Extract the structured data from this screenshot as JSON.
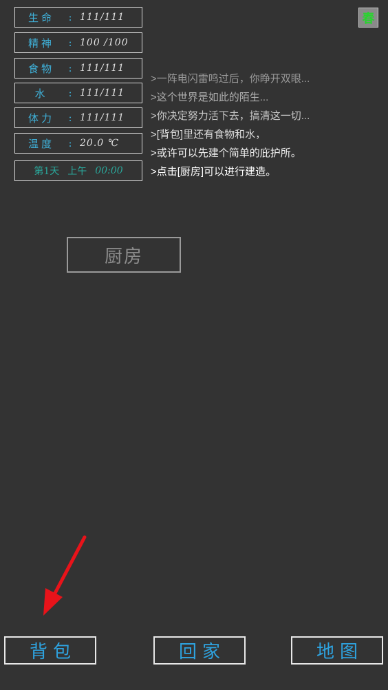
{
  "stats": [
    {
      "label": "生命",
      "separator": ":",
      "value": "111/111"
    },
    {
      "label": "精神",
      "separator": ":",
      "value": "100 /100"
    },
    {
      "label": "食物",
      "separator": ":",
      "value": "111/111"
    },
    {
      "label": "水",
      "separator": ":",
      "value": "111/111"
    },
    {
      "label": "体力",
      "separator": ":",
      "value": "111/111"
    },
    {
      "label": "温度",
      "separator": ":",
      "value": "20.0  ℃"
    }
  ],
  "time": {
    "day": "第1天",
    "period": "上午",
    "clock": "00:00"
  },
  "season": {
    "label": "春",
    "color": "#29d32f"
  },
  "log": [
    ">一阵电闪雷鸣过后，你睁开双眼...",
    ">这个世界是如此的陌生...",
    ">你决定努力活下去，搞清这一切...",
    ">[背包]里还有食物和水，",
    ">或许可以先建个简单的庇护所。",
    ">点击[厨房]可以进行建造。"
  ],
  "kitchen_button": "厨房",
  "bottom_nav": {
    "backpack": "背包",
    "home": "回家",
    "map": "地图"
  },
  "colors": {
    "background": "#333333",
    "stat_text": "#3fb0d8",
    "nav_text": "#2ea3e0",
    "arrow": "#e8131a"
  }
}
